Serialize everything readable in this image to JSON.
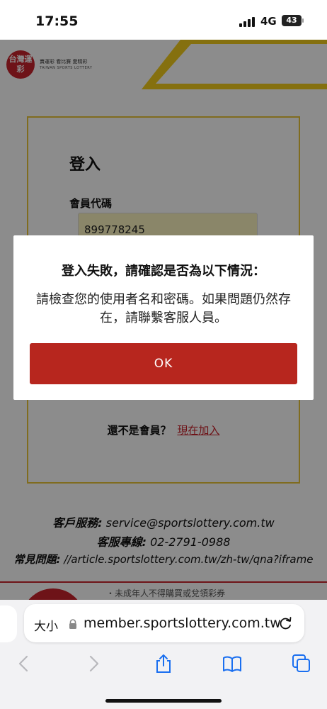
{
  "status_bar": {
    "time": "17:55",
    "network": "4G",
    "battery": "43"
  },
  "site": {
    "logo_text": "台灣運彩",
    "logo_subtitle": "TAIWAN SPORTS LOTTERY",
    "logo_tagline": "賣運彩 看比賽 愛精彩"
  },
  "login": {
    "title": "登入",
    "member_label": "會員代碼",
    "member_value": "899778245",
    "signup_question": "還不是會員？",
    "signup_link": "現在加入"
  },
  "contact": {
    "service_label": "客戶服務:",
    "service_value": "service@sportslottery.com.tw",
    "hotline_label": "客服專線:",
    "hotline_value": "02-2791-0988",
    "faq_label": "常見問題:",
    "faq_value": "//article.sportslottery.com.tw/zh-tw/qna?iframe"
  },
  "banner": {
    "text": "・未成年人不得購買或兌領彩券"
  },
  "dialog": {
    "title": "登入失敗，請確認是否為以下情況：",
    "message": "請檢查您的使用者名和密碼。如果問題仍然存在，請聯繫客服人員。",
    "ok_label": "OK"
  },
  "browser": {
    "text_size_label": "大小",
    "url": "member.sportslottery.com.tw"
  },
  "colors": {
    "brand_red": "#c8232c",
    "button_red": "#b7261e",
    "accent_yellow": "#e9c53a"
  }
}
